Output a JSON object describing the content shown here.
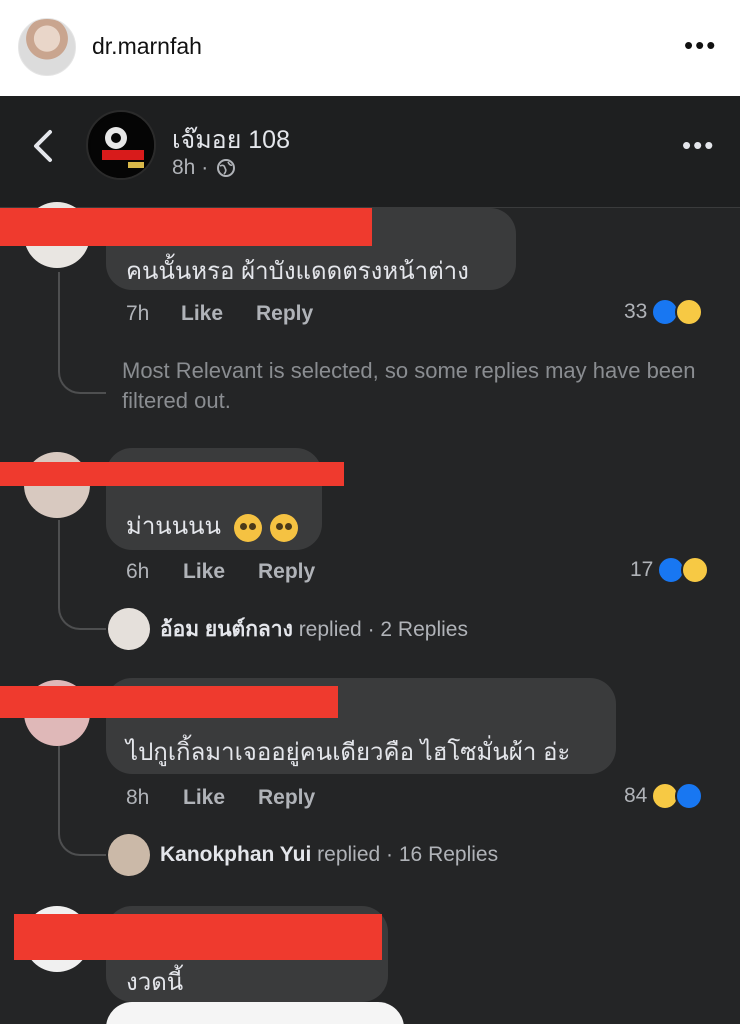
{
  "instagram": {
    "username": "dr.marnfah",
    "more_label": "•••"
  },
  "post": {
    "page_name": "เจ๊มอย 108",
    "time": "8h ·",
    "more_label": "•••"
  },
  "comments": [
    {
      "text": "คนนั้นหรอ  ผ้าบังแดดตรงหน้าต่าง",
      "time": "7h",
      "like_label": "Like",
      "reply_label": "Reply",
      "reaction_count": "33",
      "reactions": [
        "like-icon",
        "haha-icon"
      ],
      "note": "Most Relevant is selected, so some replies may have been filtered out."
    },
    {
      "text": "ม่านนนน",
      "emojis": [
        "winking-tongue-emoji",
        "winking-tongue-emoji"
      ],
      "time": "6h",
      "like_label": "Like",
      "reply_label": "Reply",
      "reaction_count": "17",
      "reactions": [
        "like-icon",
        "haha-icon"
      ],
      "reply_summary": {
        "name": "อ้อม ยนต์กลาง",
        "verb": "replied",
        "count": "· 2 Replies"
      }
    },
    {
      "text": "ไปกูเกิ้ลมาเจออยู่คนเดียวคือ ไฮโซมั่นผ้า อ่ะ",
      "time": "8h",
      "like_label": "Like",
      "reply_label": "Reply",
      "reaction_count": "84",
      "reactions": [
        "haha-icon",
        "like-icon"
      ],
      "reply_summary": {
        "name": "Kanokphan Yui",
        "verb": "replied",
        "count": "· 16 Replies"
      }
    },
    {
      "text": "งวดนี้"
    }
  ],
  "colors": {
    "fb_background": "#242526",
    "bubble": "#3a3b3c",
    "redaction": "#ef3a2e",
    "like_blue": "#1877f2",
    "haha_yellow": "#f7c944"
  }
}
